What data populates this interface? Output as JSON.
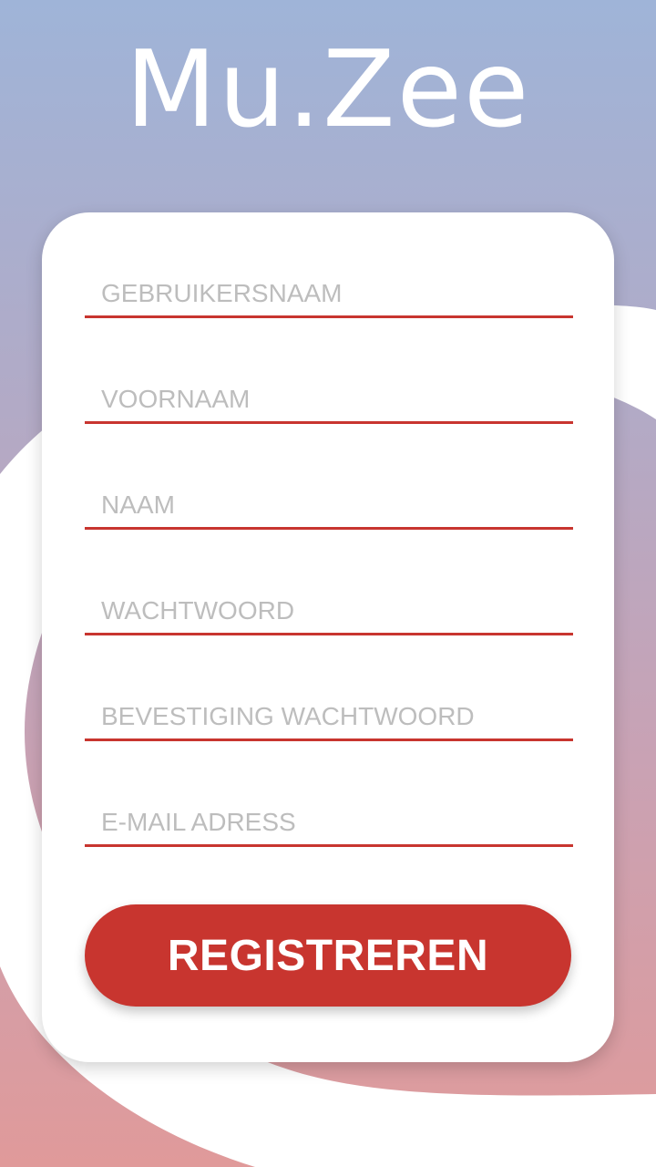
{
  "app": {
    "logo_text": "Mu.Zee"
  },
  "form": {
    "fields": [
      {
        "placeholder": "GEBRUIKERSNAAM",
        "value": ""
      },
      {
        "placeholder": "VOORNAAM",
        "value": ""
      },
      {
        "placeholder": "NAAM",
        "value": ""
      },
      {
        "placeholder": "WACHTWOORD",
        "value": ""
      },
      {
        "placeholder": "BEVESTIGING WACHTWOORD",
        "value": ""
      },
      {
        "placeholder": "E-MAIL ADRESS",
        "value": ""
      }
    ],
    "submit_label": "REGISTREREN"
  },
  "colors": {
    "accent": "#c8352f",
    "background_top": "#9fb4d8",
    "background_bottom": "#e09a9a",
    "card": "#ffffff",
    "placeholder": "#bdbdbd"
  }
}
